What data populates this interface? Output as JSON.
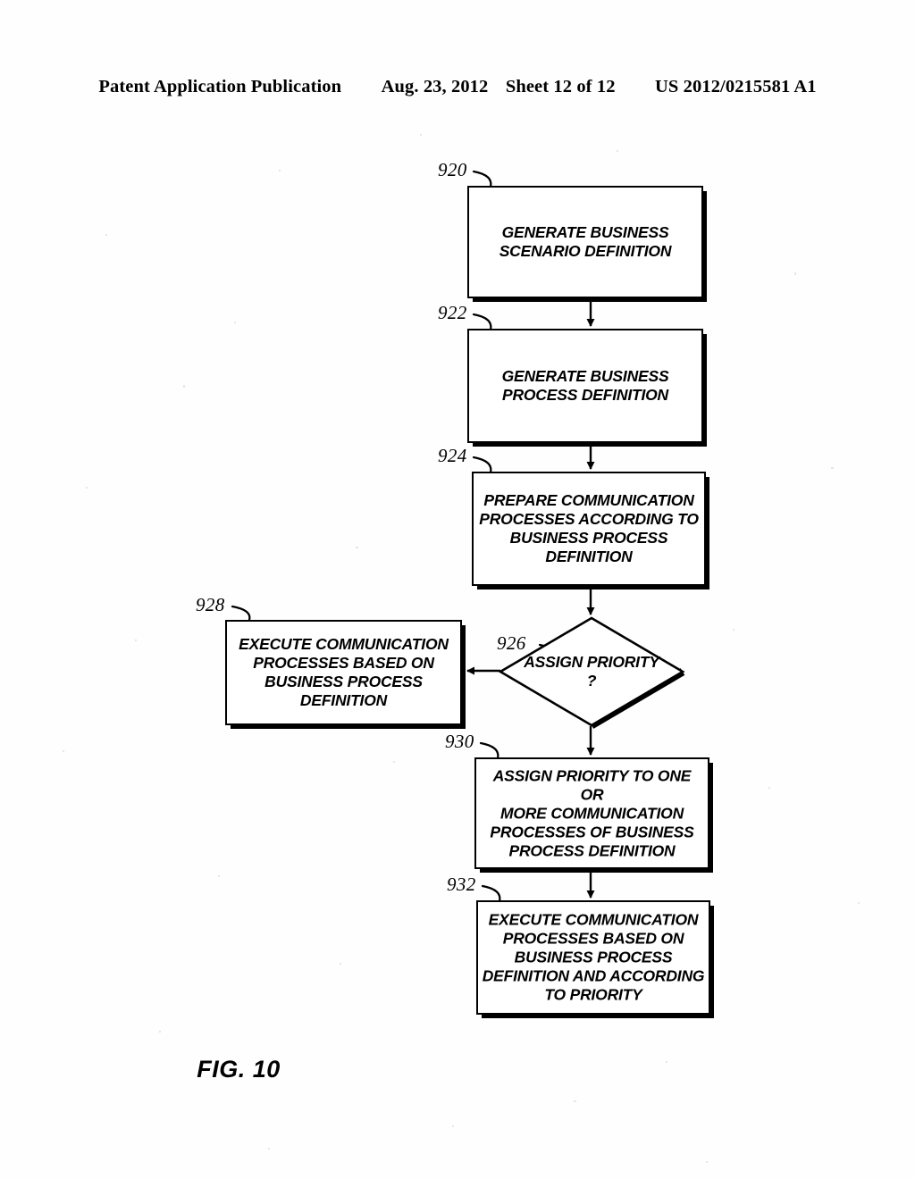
{
  "header": {
    "publication": "Patent Application Publication",
    "date": "Aug. 23, 2012",
    "sheet": "Sheet 12 of 12",
    "document_number": "US 2012/0215581 A1"
  },
  "figure": {
    "caption": "FIG. 10",
    "nodes": [
      {
        "ref": "920",
        "shape": "process",
        "text": "GENERATE BUSINESS\nSCENARIO DEFINITION"
      },
      {
        "ref": "922",
        "shape": "process",
        "text": "GENERATE BUSINESS\nPROCESS DEFINITION"
      },
      {
        "ref": "924",
        "shape": "process",
        "text": "PREPARE COMMUNICATION\nPROCESSES ACCORDING TO\nBUSINESS PROCESS\nDEFINITION"
      },
      {
        "ref": "926",
        "shape": "decision",
        "text": "ASSIGN PRIORITY\n?"
      },
      {
        "ref": "928",
        "shape": "process",
        "text": "EXECUTE COMMUNICATION\nPROCESSES BASED ON\nBUSINESS PROCESS\nDEFINITION"
      },
      {
        "ref": "930",
        "shape": "process",
        "text": "ASSIGN PRIORITY TO ONE OR\nMORE COMMUNICATION\nPROCESSES OF BUSINESS\nPROCESS DEFINITION"
      },
      {
        "ref": "932",
        "shape": "process",
        "text": "EXECUTE COMMUNICATION\nPROCESSES BASED ON\nBUSINESS PROCESS\nDEFINITION AND ACCORDING\nTO PRIORITY"
      }
    ]
  },
  "colors": {
    "ink": "#000000",
    "paper": "#ffffff"
  }
}
